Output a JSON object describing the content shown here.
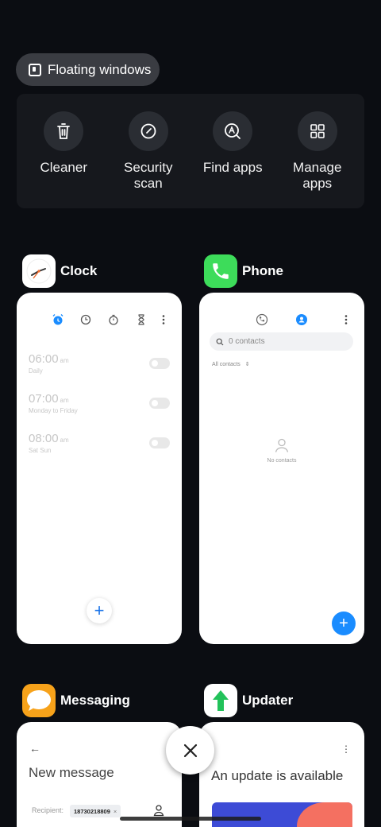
{
  "floating_button": {
    "label": "Floating windows",
    "icon": "floating-window-icon"
  },
  "quick_actions": [
    {
      "label": "Cleaner",
      "icon": "trash-icon"
    },
    {
      "label": "Security scan",
      "icon": "security-scan-icon"
    },
    {
      "label": "Find apps",
      "icon": "find-apps-icon"
    },
    {
      "label": "Manage apps",
      "icon": "grid-icon"
    }
  ],
  "apps": {
    "clock": {
      "name": "Clock",
      "alarms": [
        {
          "time": "06:00",
          "ampm": "am",
          "repeat": "Daily"
        },
        {
          "time": "07:00",
          "ampm": "am",
          "repeat": "Monday to Friday"
        },
        {
          "time": "08:00",
          "ampm": "am",
          "repeat": "Sat Sun"
        }
      ],
      "fab": "+"
    },
    "phone": {
      "name": "Phone",
      "search_placeholder": "0 contacts",
      "filter": "All contacts",
      "empty": "No contacts",
      "fab": "+",
      "icon_color": "#3ddc5a"
    },
    "messaging": {
      "name": "Messaging",
      "back": "←",
      "title": "New message",
      "recipient_label": "Recipient:",
      "recipient_chip": "18730218809",
      "chip_remove": "×",
      "icon_color": "#f7a21a"
    },
    "updater": {
      "name": "Updater",
      "title": "An update is available",
      "menu": "⋮"
    }
  },
  "colors": {
    "accent": "#1a8cff",
    "background": "#0b0d12"
  }
}
